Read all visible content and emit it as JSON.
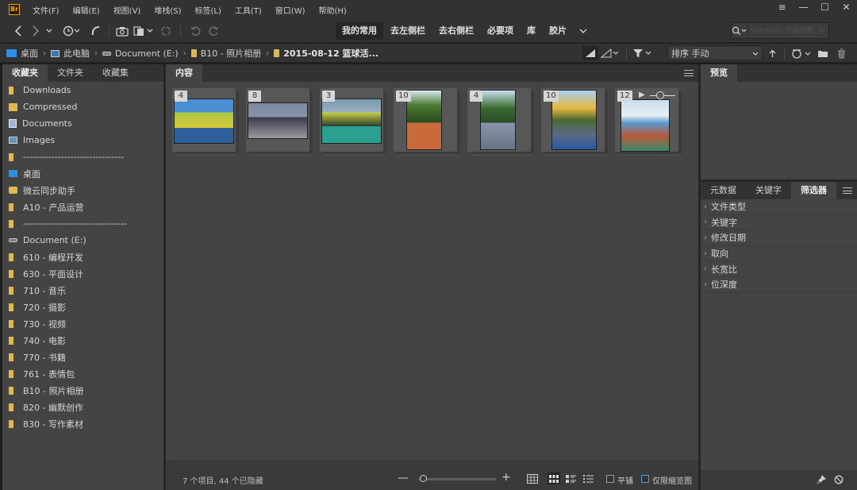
{
  "app": {
    "logo_text": "Br"
  },
  "menu": [
    "文件(F)",
    "编辑(E)",
    "视图(V)",
    "堆栈(S)",
    "标签(L)",
    "工具(T)",
    "窗口(W)",
    "帮助(H)"
  ],
  "window_controls": {
    "more": "≡",
    "minimize": "—",
    "maximize": "☐",
    "close": "✕"
  },
  "toolbar": {
    "workspaces": [
      {
        "label": "我的常用",
        "active": true
      },
      {
        "label": "去左侧栏",
        "active": false
      },
      {
        "label": "去右侧栏",
        "active": false
      },
      {
        "label": "必要项",
        "active": false
      },
      {
        "label": "库",
        "active": false
      },
      {
        "label": "胶片",
        "active": false
      }
    ],
    "more_arrow": "⌄",
    "search_placeholder": "Windows 资源搜索: 中"
  },
  "breadcrumb": [
    {
      "label": "桌面",
      "icon": "desktop-icon"
    },
    {
      "label": "此电脑",
      "icon": "computer-icon"
    },
    {
      "label": "Document (E:)",
      "icon": "drive-icon"
    },
    {
      "label": "B10 - 照片相册",
      "icon": "folder-icon"
    },
    {
      "label": "2015-08-12 篮球活...",
      "icon": "folder-icon"
    }
  ],
  "sort": {
    "label": "排序 手动"
  },
  "left_panel": {
    "tabs": [
      {
        "label": "收藏夹",
        "active": true
      },
      {
        "label": "文件夹",
        "active": false
      },
      {
        "label": "收藏集",
        "active": false
      }
    ],
    "items": [
      {
        "label": "Downloads",
        "icon": "folder-icon"
      },
      {
        "label": "Compressed",
        "icon": "compressed-folder-icon"
      },
      {
        "label": "Documents",
        "icon": "documents-icon"
      },
      {
        "label": "Images",
        "icon": "images-icon"
      },
      {
        "label": "--------------------------------",
        "icon": "folder-icon"
      },
      {
        "label": "桌面",
        "icon": "desktop-icon"
      },
      {
        "label": "微云同步助手",
        "icon": "cloud-folder-icon"
      },
      {
        "label": "A10 - 产品运营",
        "icon": "folder-icon"
      },
      {
        "label": "---------------------------------",
        "icon": "folder-icon"
      },
      {
        "label": "Document (E:)",
        "icon": "drive-icon"
      },
      {
        "label": "610 - 编程开发",
        "icon": "folder-icon"
      },
      {
        "label": "630 - 平面设计",
        "icon": "folder-icon"
      },
      {
        "label": "710 - 音乐",
        "icon": "folder-icon"
      },
      {
        "label": "720 - 摄影",
        "icon": "folder-icon"
      },
      {
        "label": "730 - 视频",
        "icon": "folder-icon"
      },
      {
        "label": "740 - 电影",
        "icon": "folder-icon"
      },
      {
        "label": "770 - 书籍",
        "icon": "folder-icon"
      },
      {
        "label": "761 - 表情包",
        "icon": "folder-icon"
      },
      {
        "label": "B10 - 照片相册",
        "icon": "folder-icon"
      },
      {
        "label": "820 - 幽默创作",
        "icon": "folder-icon"
      },
      {
        "label": "830 - 写作素材",
        "icon": "folder-icon"
      }
    ]
  },
  "content": {
    "tab": "内容",
    "thumbnails": [
      {
        "count": "4"
      },
      {
        "count": "8"
      },
      {
        "count": "3"
      },
      {
        "count": "10"
      },
      {
        "count": "4"
      },
      {
        "count": "10"
      },
      {
        "count": "12"
      }
    ],
    "status": "7 个项目, 44 个已隐藏",
    "zoom_minus": "—",
    "zoom_plus": "+",
    "zoom_level": 0.02,
    "checkbox_tile": "平铺",
    "checkbox_thumbs_only": "仅限缩览图"
  },
  "preview_panel": {
    "tab": "预览"
  },
  "meta_panel": {
    "tabs": [
      {
        "label": "元数据",
        "active": false
      },
      {
        "label": "关键字",
        "active": false
      },
      {
        "label": "筛选器",
        "active": true
      }
    ],
    "filters": [
      "文件类型",
      "关键字",
      "修改日期",
      "取向",
      "长宽比",
      "位深度"
    ]
  }
}
